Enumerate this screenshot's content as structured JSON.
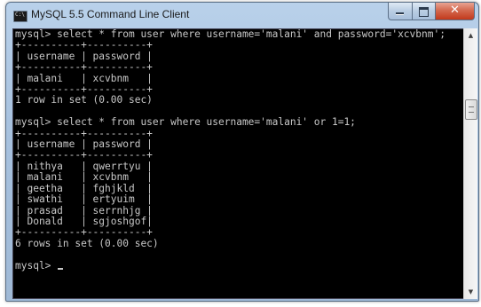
{
  "window": {
    "title": "MySQL 5.5 Command Line Client",
    "icon": "console-app-icon",
    "icon_text": "C:\\",
    "close_glyph": "✕"
  },
  "scrollbar": {
    "up_arrow": "▲",
    "down_arrow": "▼"
  },
  "terminal": {
    "lines": [
      "mysql> select * from user where username='malani' and password='xcvbnm';",
      "+----------+----------+",
      "| username | password |",
      "+----------+----------+",
      "| malani   | xcvbnm   |",
      "+----------+----------+",
      "1 row in set (0.00 sec)",
      "",
      "mysql> select * from user where username='malani' or 1=1;",
      "+----------+----------+",
      "| username | password |",
      "+----------+----------+",
      "| nithya   | qwerrtyu |",
      "| malani   | xcvbnm   |",
      "| geetha   | fghjkld  |",
      "| swathi   | ertyuim  |",
      "| prasad   | serrnhjg |",
      "| Donald   | sgjoshgof|",
      "+----------+----------+",
      "6 rows in set (0.00 sec)",
      "",
      "mysql> "
    ]
  }
}
